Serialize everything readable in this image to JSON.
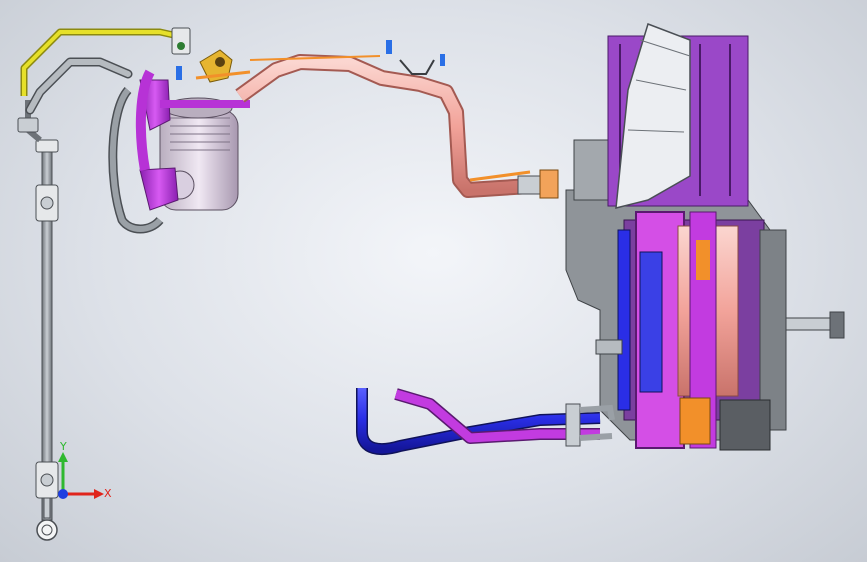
{
  "viewport": {
    "background_top": "#f3f5f9",
    "background_edge": "#c7ccd4"
  },
  "triad": {
    "x_label": "X",
    "y_label": "Y",
    "x_color": "#e0241b",
    "y_color": "#2fb82f",
    "z_color": "#1f3fe0"
  },
  "colors": {
    "magenta": "#c23be0",
    "pink_hose": "#f2a39a",
    "blue_pipe": "#2a2ee6",
    "yellow_line": "#e6e02a",
    "gray_metal": "#9aa0a6",
    "orange_part": "#f2902a"
  },
  "icons": {
    "triad": "coordinate-triad-icon"
  }
}
